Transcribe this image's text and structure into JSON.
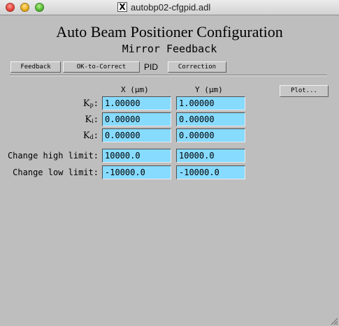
{
  "window": {
    "title": "autobp02-cfgpid.adl",
    "x_icon": "X"
  },
  "header": {
    "title": "Auto Beam Positioner Configuration",
    "subtitle": "Mirror Feedback"
  },
  "tabs": {
    "feedback": "Feedback",
    "ok_to_correct": "OK-to-Correct",
    "current": "PID",
    "correction": "Correction"
  },
  "columns": {
    "x": "X (μm)",
    "y": "Y (μm)"
  },
  "plot_button": "Plot...",
  "rows": {
    "kp": {
      "symbol": "K",
      "sub": "p",
      "x": "1.00000",
      "y": "1.00000"
    },
    "ki": {
      "symbol": "K",
      "sub": "i",
      "x": "0.00000",
      "y": "0.00000"
    },
    "kd": {
      "symbol": "K",
      "sub": "d",
      "x": "0.00000",
      "y": "0.00000"
    },
    "high": {
      "label": "Change high limit:",
      "x": "10000.0",
      "y": "10000.0"
    },
    "low": {
      "label": "Change low limit:",
      "x": "-10000.0",
      "y": "-10000.0"
    }
  },
  "colors": {
    "field_bg": "#87dbff",
    "panel_bg": "#bebebe"
  }
}
